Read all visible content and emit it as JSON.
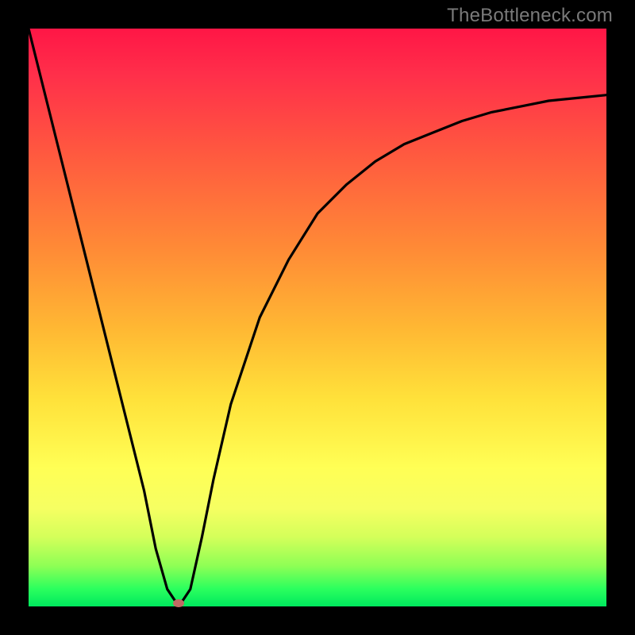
{
  "watermark": "TheBottleneck.com",
  "chart_data": {
    "type": "line",
    "title": "",
    "xlabel": "",
    "ylabel": "",
    "xlim": [
      0,
      100
    ],
    "ylim": [
      0,
      100
    ],
    "grid": false,
    "series": [
      {
        "name": "bottleneck-curve",
        "x": [
          0,
          5,
          10,
          15,
          20,
          22,
          24,
          26,
          28,
          30,
          32,
          35,
          40,
          45,
          50,
          55,
          60,
          65,
          70,
          75,
          80,
          85,
          90,
          95,
          100
        ],
        "values": [
          100,
          80,
          60,
          40,
          20,
          10,
          3,
          0,
          3,
          12,
          22,
          35,
          50,
          60,
          68,
          73,
          77,
          80,
          82,
          84,
          85.5,
          86.5,
          87.5,
          88,
          88.5
        ]
      }
    ],
    "minimum_marker": {
      "x": 26,
      "y": 0.5
    },
    "background_gradient_stops": [
      {
        "pos": 0,
        "color": "#ff1646"
      },
      {
        "pos": 22,
        "color": "#ff5a3f"
      },
      {
        "pos": 52,
        "color": "#ffb833"
      },
      {
        "pos": 76,
        "color": "#ffff55"
      },
      {
        "pos": 93,
        "color": "#8eff55"
      },
      {
        "pos": 100,
        "color": "#00e85e"
      }
    ]
  }
}
